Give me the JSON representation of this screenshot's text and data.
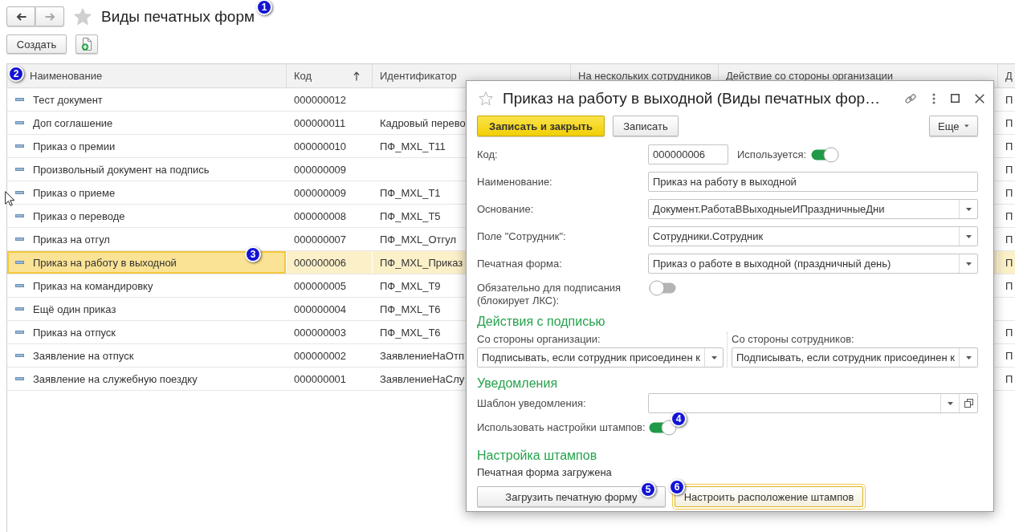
{
  "navigation": [
    {
      "kind": "back",
      "disabled": false
    },
    {
      "kind": "forward",
      "disabled": true
    }
  ],
  "page": {
    "title": "Виды печатных форм",
    "favorite": false,
    "callout": "1"
  },
  "toolbar": [
    {
      "kind": "text",
      "label": "Создать"
    },
    {
      "kind": "add_document"
    }
  ],
  "table": {
    "columns": [
      {
        "label": "Наименование",
        "callout": "2"
      },
      {
        "label": "Код",
        "sorted": true
      },
      {
        "label": "Идентификатор"
      },
      {
        "label": "На нескольких сотрудников"
      },
      {
        "label": "Действие со стороны организации"
      },
      {
        "label": "Д"
      }
    ],
    "rows": [
      {
        "name": "Тест документ",
        "code": "000000012",
        "column_6": "П",
        "selected": false
      },
      {
        "name": "Доп соглашение",
        "code": "000000011",
        "identifier": "Кадровый перево",
        "column_6": "П",
        "selected": false
      },
      {
        "name": "Приказ о премии",
        "code": "000000010",
        "identifier": "ПФ_MXL_Т11",
        "column_6": "П",
        "selected": false
      },
      {
        "name": "Произвольный документ на подпись",
        "code": "000000009",
        "column_6": "П",
        "selected": false
      },
      {
        "name": "Приказ о приеме",
        "code": "000000009",
        "identifier": "ПФ_MXL_Т1",
        "column_6": "П",
        "selected": false
      },
      {
        "name": "Приказ о переводе",
        "code": "000000008",
        "identifier": "ПФ_MXL_Т5",
        "column_6": "П",
        "selected": false
      },
      {
        "name": "Приказ на отгул",
        "code": "000000007",
        "identifier": "ПФ_MXL_Отгул",
        "column_6": "П",
        "selected": false
      },
      {
        "name": "Приказ на работу в выходной",
        "code": "000000006",
        "identifier": "ПФ_MXL_Приказ",
        "column_6": "П",
        "selected": true,
        "callout": "3"
      },
      {
        "name": "Приказ на командировку",
        "code": "000000005",
        "identifier": "ПФ_MXL_Т9",
        "column_6": "П",
        "selected": false
      },
      {
        "name": "Ещё один приказ",
        "code": "000000004",
        "identifier": "ПФ_MXL_Т6",
        "selected": false
      },
      {
        "name": "Приказ на отпуск",
        "code": "000000003",
        "identifier": "ПФ_MXL_Т6",
        "column_6": "П",
        "selected": false
      },
      {
        "name": "Заявление на отпуск",
        "code": "000000002",
        "identifier": "ЗаявлениеНаОтп",
        "column_6": "П",
        "selected": false
      },
      {
        "name": "Заявление на служебную поездку",
        "code": "000000001",
        "identifier": "ЗаявлениеНаСлу",
        "column_6": "П",
        "selected": false
      }
    ]
  },
  "dialog": {
    "title": "Приказ на работу в выходной (Виды печатных фор…",
    "favorite": false,
    "buttons": [
      {
        "kind": "primary",
        "label": "Записать и закрыть"
      },
      {
        "kind": "normal",
        "label": "Записать"
      }
    ],
    "more_button": "Еще",
    "form": [
      {
        "kind": "code",
        "label": "Код:",
        "value": "000000006",
        "switch_label": "Используется:",
        "on": true
      },
      {
        "kind": "text",
        "label": "Наименование:",
        "value": "Приказ на работу в выходной"
      },
      {
        "kind": "select",
        "label": "Основание:",
        "value": "Документ.РаботаВВыходныеИПраздничныеДни"
      },
      {
        "kind": "select",
        "label": "Поле \"Сотрудник\":",
        "value": "Сотрудники.Сотрудник"
      },
      {
        "kind": "select",
        "label": "Печатная форма:",
        "value": "Приказ о работе в выходной (праздничный день)"
      },
      {
        "kind": "switch",
        "label": "Обязательно для подписания (блокирует ЛКС):",
        "on": false
      },
      {
        "kind": "heading",
        "text": "Действия с подписью"
      },
      {
        "kind": "pair",
        "columns": [
          {
            "label": "Со стороны организации:",
            "value": "Подписывать, если сотрудник присоединен к"
          },
          {
            "label": "Со стороны сотрудников:",
            "value": "Подписывать, если сотрудник присоединен к"
          }
        ]
      },
      {
        "kind": "heading",
        "text": "Уведомления"
      },
      {
        "kind": "select_open",
        "label": "Шаблон уведомления:"
      },
      {
        "kind": "switch",
        "label": "Использовать настройки штампов:",
        "on": true,
        "callout": "4"
      },
      {
        "kind": "heading",
        "text": "Настройка штампов"
      },
      {
        "kind": "note",
        "text": "Печатная форма загружена"
      },
      {
        "kind": "buttons",
        "buttons": [
          {
            "label": "Загрузить печатную форму",
            "focused": false,
            "callout": "5"
          },
          {
            "label": "Настроить расположение штампов",
            "focused": true,
            "callout": "6"
          }
        ]
      }
    ]
  }
}
